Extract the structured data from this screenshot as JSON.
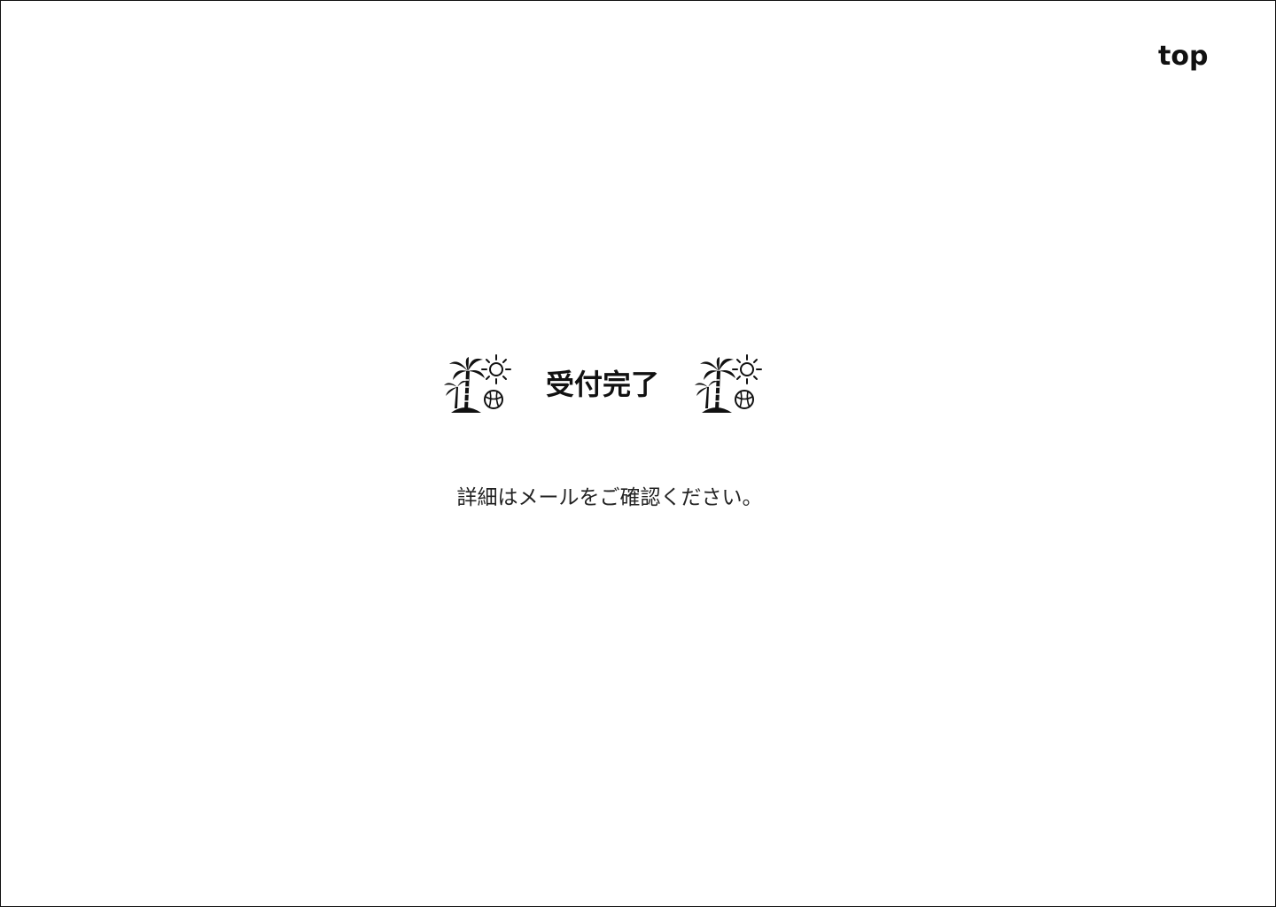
{
  "nav": {
    "top_label": "top"
  },
  "main": {
    "title": "受付完了",
    "message": "詳細はメールをご確認ください。",
    "decor_icon": "palm-beach-icon"
  },
  "colors": {
    "background": "#ffffff",
    "text": "#111111",
    "border": "#111111"
  }
}
